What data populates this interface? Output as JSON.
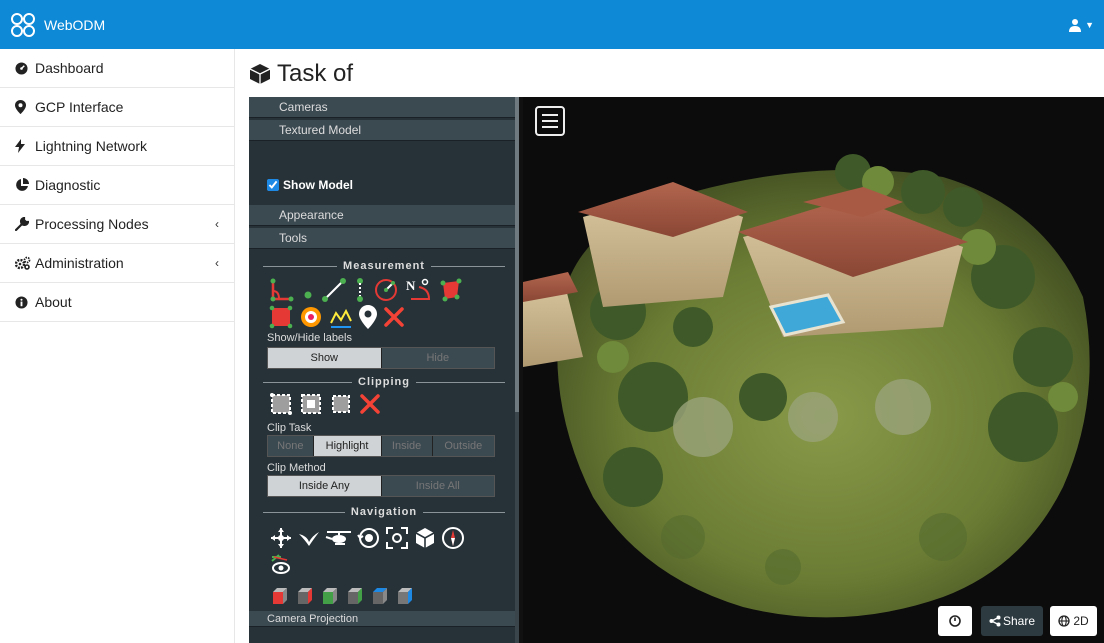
{
  "app": {
    "title": "WebODM"
  },
  "sidebar": {
    "items": [
      {
        "label": "Dashboard",
        "icon": "dashboard-icon"
      },
      {
        "label": "GCP Interface",
        "icon": "map-marker-icon"
      },
      {
        "label": "Lightning Network",
        "icon": "bolt-icon"
      },
      {
        "label": "Diagnostic",
        "icon": "pie-chart-icon"
      },
      {
        "label": "Processing Nodes",
        "icon": "wrench-icon",
        "expandable": true
      },
      {
        "label": "Administration",
        "icon": "cogs-icon",
        "expandable": true
      },
      {
        "label": "About",
        "icon": "info-icon"
      }
    ]
  },
  "page": {
    "title": "Task of"
  },
  "panel": {
    "sections": [
      "Cameras",
      "Textured Model",
      "Appearance",
      "Tools"
    ],
    "show_model": {
      "label": "Show Model",
      "checked": true
    },
    "measurement": {
      "title": "Measurement",
      "show_hide_label": "Show/Hide labels",
      "options": [
        "Show",
        "Hide"
      ],
      "selected": "Show"
    },
    "clipping": {
      "title": "Clipping",
      "clip_task_label": "Clip Task",
      "clip_task_options": [
        "None",
        "Highlight",
        "Inside",
        "Outside"
      ],
      "clip_task_selected": "Highlight",
      "clip_method_label": "Clip Method",
      "clip_method_options": [
        "Inside Any",
        "Inside All"
      ],
      "clip_method_selected": "Inside Any"
    },
    "navigation": {
      "title": "Navigation"
    },
    "camera_projection": "Camera Projection"
  },
  "viewer": {
    "share_label": "Share",
    "view_2d_label": "2D"
  },
  "colors": {
    "topbar": "#0d89d6",
    "panel": "#263238"
  }
}
